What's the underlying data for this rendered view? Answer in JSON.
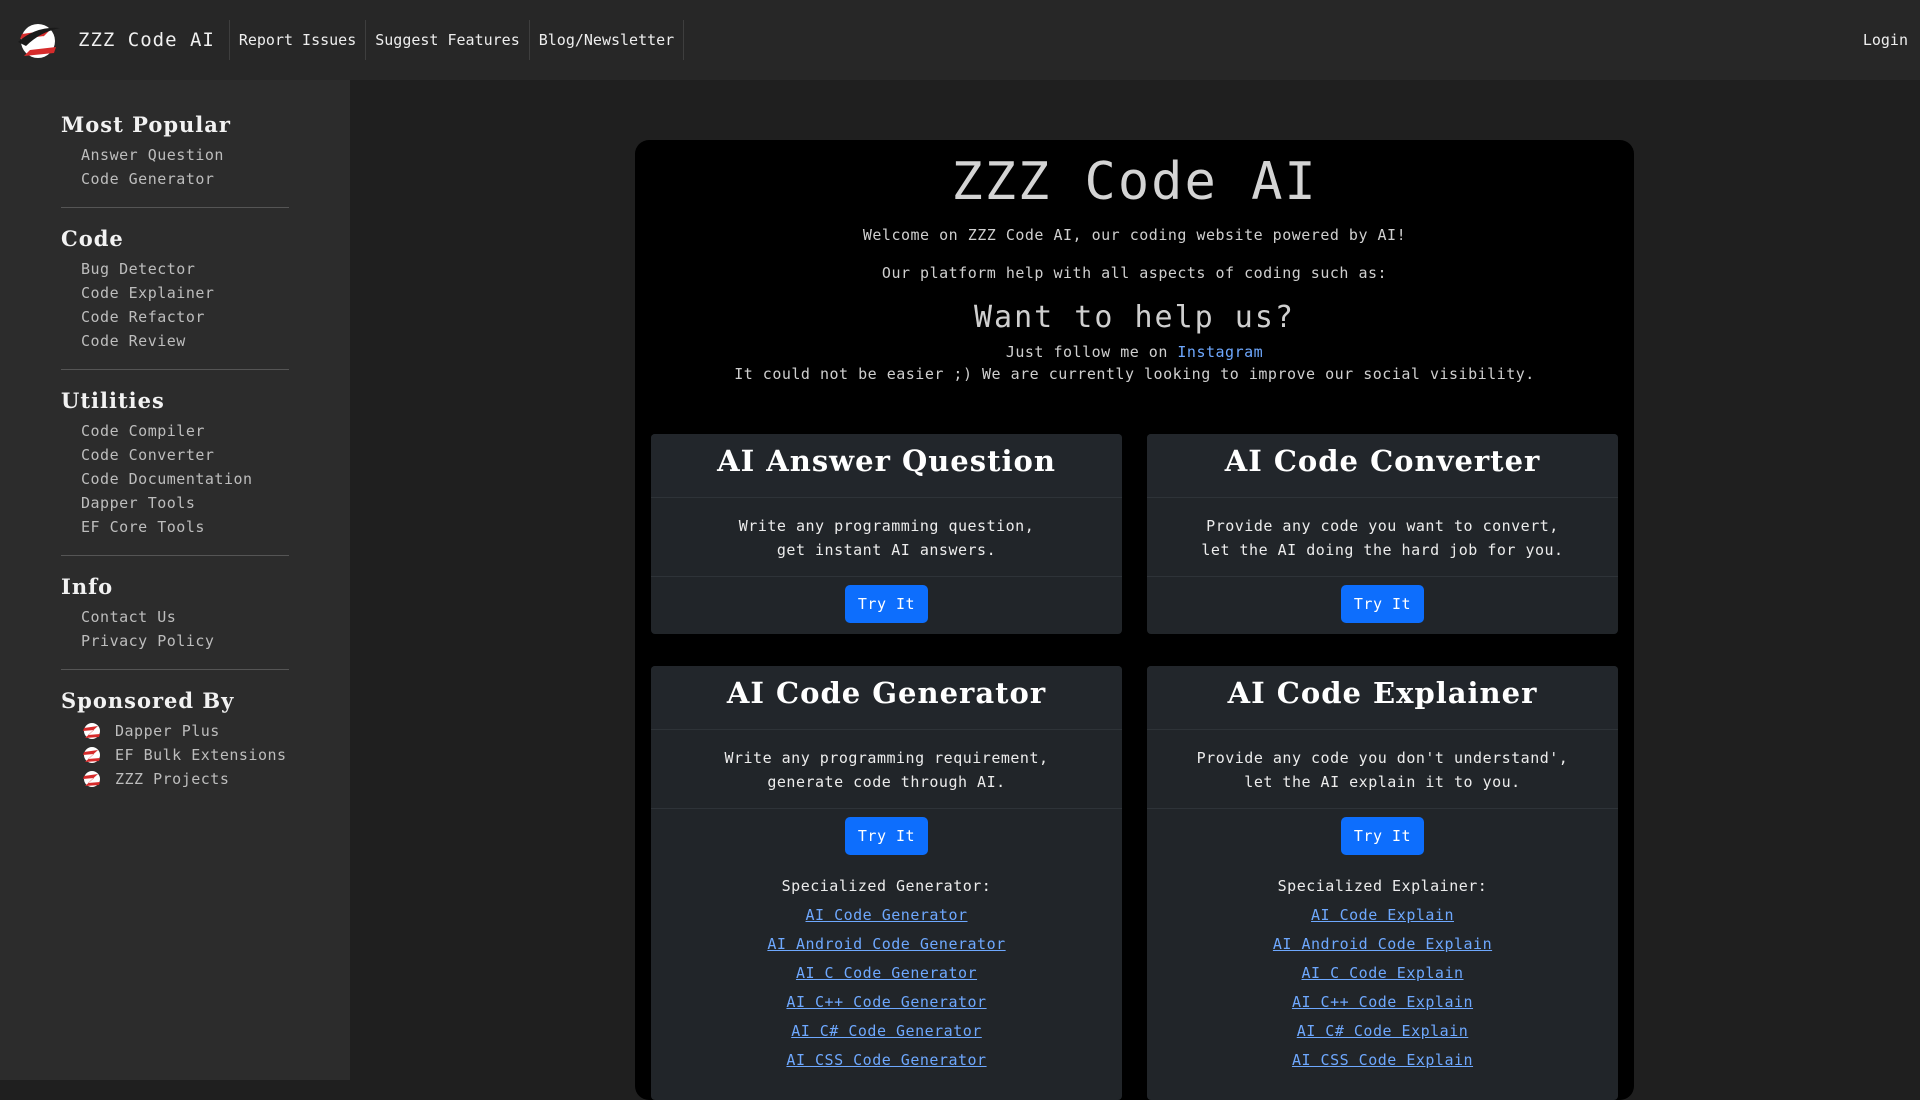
{
  "nav": {
    "brand": "ZZZ Code AI",
    "links": [
      "Report Issues",
      "Suggest Features",
      "Blog/Newsletter"
    ],
    "login": "Login"
  },
  "sidebar": {
    "sections": [
      {
        "title": "Most Popular",
        "items": [
          "Answer Question",
          "Code Generator"
        ]
      },
      {
        "title": "Code",
        "items": [
          "Bug Detector",
          "Code Explainer",
          "Code Refactor",
          "Code Review"
        ]
      },
      {
        "title": "Utilities",
        "items": [
          "Code Compiler",
          "Code Converter",
          "Code Documentation",
          "Dapper Tools",
          "EF Core Tools"
        ]
      },
      {
        "title": "Info",
        "items": [
          "Contact Us",
          "Privacy Policy"
        ]
      }
    ],
    "sponsored": {
      "title": "Sponsored By",
      "items": [
        "Dapper Plus",
        "EF Bulk Extensions",
        "ZZZ Projects"
      ]
    }
  },
  "hero": {
    "title": "ZZZ Code AI",
    "welcome": "Welcome on ZZZ Code AI, our coding website powered by AI!",
    "platform": "Our platform help with all aspects of coding such as:",
    "help_title": "Want to help us?",
    "follow_prefix": "Just follow me on ",
    "instagram": "Instagram",
    "easier": "It could not be easier ;) We are currently looking to improve our social visibility."
  },
  "cards": {
    "answer": {
      "title": "AI Answer Question",
      "line1": "Write any programming question,",
      "line2": "get instant AI answers.",
      "button": "Try It"
    },
    "converter": {
      "title": "AI Code Converter",
      "line1": "Provide any code you want to convert,",
      "line2": "let the AI doing the hard job for you.",
      "button": "Try It"
    },
    "generator": {
      "title": "AI Code Generator",
      "line1": "Write any programming requirement,",
      "line2": "generate code through AI.",
      "button": "Try It",
      "spec_title": "Specialized Generator:",
      "links": [
        "AI Code Generator",
        "AI Android Code Generator",
        "AI C Code Generator",
        "AI C++ Code Generator",
        "AI C# Code Generator",
        "AI CSS Code Generator"
      ]
    },
    "explainer": {
      "title": "AI Code Explainer",
      "line1": "Provide any code you don't understand',",
      "line2": "let the AI explain it to you.",
      "button": "Try It",
      "spec_title": "Specialized Explainer:",
      "links": [
        "AI Code Explain",
        "AI Android Code Explain",
        "AI C Code Explain",
        "AI C++ Code Explain",
        "AI C# Code Explain",
        "AI CSS Code Explain"
      ]
    }
  },
  "colors": {
    "primary": "#0d6efd",
    "link": "#6ea8fe",
    "logo_red": "#d62b2b"
  }
}
